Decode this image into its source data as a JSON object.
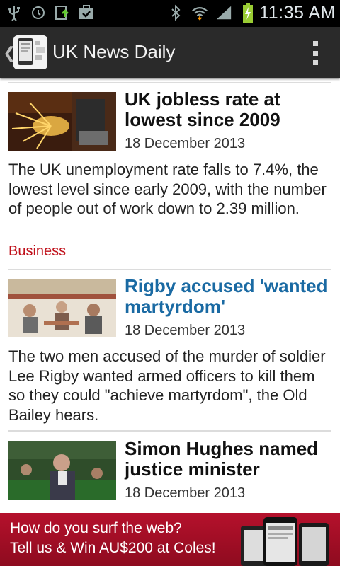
{
  "status_bar": {
    "time": "11:35 AM",
    "left_icons": [
      "usb-icon",
      "sync-icon",
      "upload-icon",
      "briefcase-check-icon"
    ],
    "right_icons": [
      "bluetooth-icon",
      "wifi-icon",
      "signal-icon",
      "battery-charging-icon"
    ]
  },
  "action_bar": {
    "title": "UK News Daily"
  },
  "articles": [
    {
      "headline": "UK jobless rate at lowest since 2009",
      "date": "18 December 2013",
      "summary": "The UK unemployment rate falls to 7.4%, the lowest level since early 2009, with the number of people out of work down to 2.39 million.",
      "category": "Business"
    },
    {
      "headline": "Rigby accused 'wanted martyrdom'",
      "date": "18 December 2013",
      "summary": "The two men accused of the murder of soldier Lee Rigby wanted armed officers to kill them so they could \"achieve martyrdom\", the Old Bailey hears."
    },
    {
      "headline": "Simon Hughes named justice minister",
      "date": "18 December 2013"
    }
  ],
  "ad": {
    "line1": "How do you surf the web?",
    "line2": "Tell us & Win AU$200 at Coles!"
  },
  "colors": {
    "headline_visited": "#1a6aa3",
    "category": "#c0101a",
    "ad_background": "#a50f27"
  }
}
